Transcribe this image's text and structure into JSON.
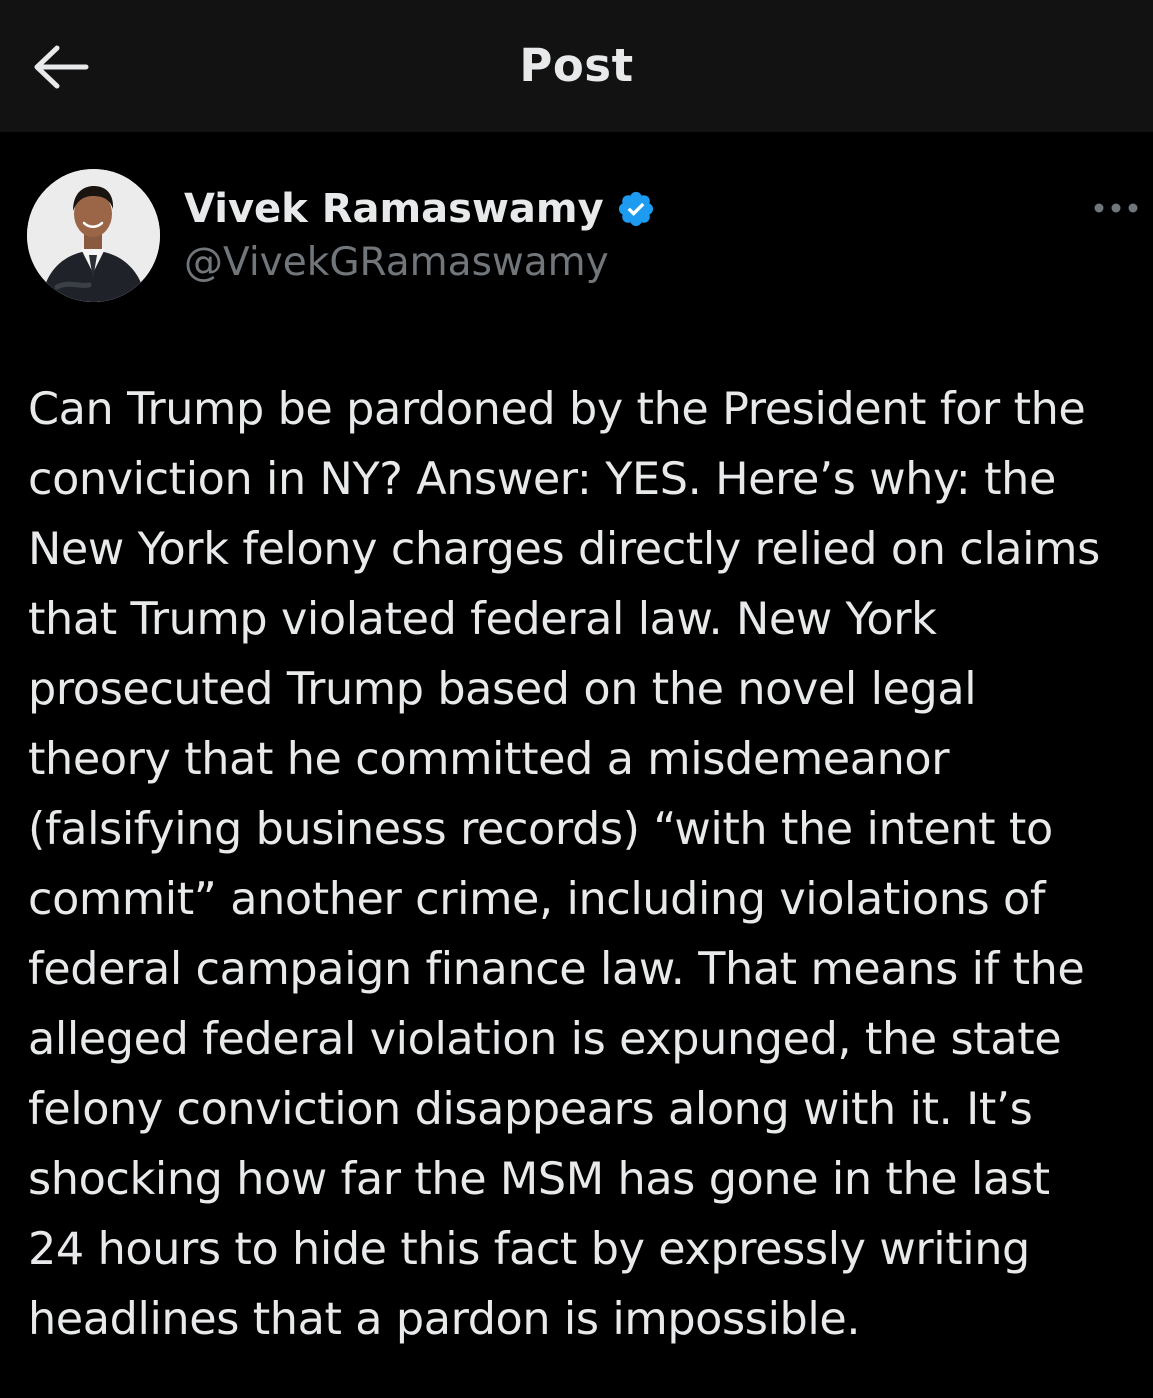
{
  "header": {
    "title": "Post",
    "back_icon": "arrow-left-icon"
  },
  "author": {
    "display_name": "Vivek Ramaswamy",
    "handle": "@VivekGRamaswamy",
    "verified": true,
    "avatar": "profile-photo"
  },
  "post": {
    "text": "Can Trump be pardoned by the President for the\nconviction in NY? Answer: YES. Here’s why: the\nNew York felony charges directly relied on claims\nthat Trump violated federal law. New York\nprosecuted Trump based on the novel legal\ntheory that he committed a misdemeanor\n(falsifying business records) “with the intent to\ncommit” another crime, including violations of\nfederal campaign finance law. That means if the\nalleged federal violation is expunged, the state\nfelony conviction disappears along with it. It’s\nshocking  how far the MSM has gone in the last\n24 hours to hide this fact by expressly writing\nheadlines that a pardon is impossible."
  },
  "colors": {
    "background": "#000000",
    "header_background": "#121212",
    "text_primary": "#e7e9ea",
    "text_secondary": "#71767b",
    "verified_blue": "#1d9bf0"
  },
  "icons": {
    "more": "more-horizontal-icon",
    "verified": "verified-badge-icon"
  }
}
